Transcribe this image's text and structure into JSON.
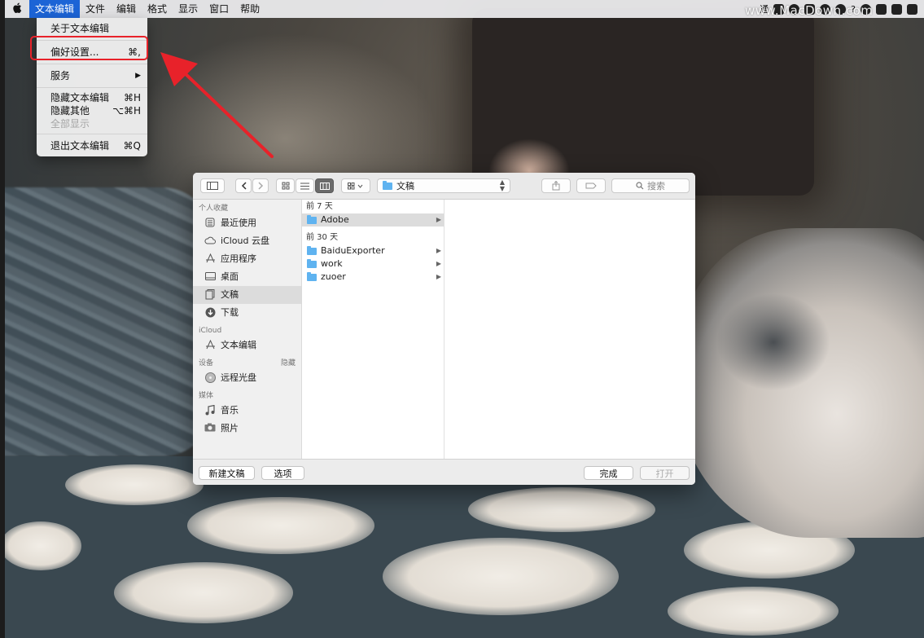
{
  "menubar": {
    "apple_icon": "apple-icon",
    "items": [
      "文本编辑",
      "文件",
      "编辑",
      "格式",
      "显示",
      "窗口",
      "帮助"
    ],
    "active_index": 0,
    "status_text": "通",
    "status_question": "?"
  },
  "watermark": "www.MacDown.com",
  "app_menu": {
    "about": "关于文本编辑",
    "preferences": "偏好设置...",
    "preferences_shortcut": "⌘,",
    "services": "服务",
    "services_arrow": "▶",
    "hide_app": "隐藏文本编辑",
    "hide_app_shortcut": "⌘H",
    "hide_others": "隐藏其他",
    "hide_others_shortcut": "⌥⌘H",
    "show_all": "全部显示",
    "quit": "退出文本编辑",
    "quit_shortcut": "⌘Q"
  },
  "annotation": {
    "highlight_color": "#e8222a",
    "arrow_color": "#e8222a"
  },
  "dialog": {
    "toolbar": {
      "sidebar_toggle_icon": "sidebar-icon",
      "back_icon": "chevron-left-icon",
      "forward_icon": "chevron-right-icon",
      "view_icon_icon": "grid-icon",
      "view_list_icon": "list-icon",
      "view_column_icon": "columns-icon",
      "group_icon": "group-icon",
      "path_location": "文稿",
      "share_icon": "share-icon",
      "tag_icon": "tag-icon",
      "search_placeholder": "搜索"
    },
    "sidebar": {
      "favorites_header": "个人收藏",
      "favorites": [
        {
          "label": "最近使用",
          "icon": "recents-icon"
        },
        {
          "label": "iCloud 云盘",
          "icon": "cloud-icon"
        },
        {
          "label": "应用程序",
          "icon": "applications-icon"
        },
        {
          "label": "桌面",
          "icon": "desktop-icon"
        },
        {
          "label": "文稿",
          "icon": "documents-icon"
        },
        {
          "label": "下载",
          "icon": "downloads-icon"
        }
      ],
      "selected_index": 4,
      "icloud_header": "iCloud",
      "icloud_items": [
        {
          "label": "文本编辑",
          "icon": "applications-icon"
        }
      ],
      "devices_header": "设备",
      "devices_hide": "隐藏",
      "devices": [
        {
          "label": "远程光盘",
          "icon": "disc-icon"
        }
      ],
      "media_header": "媒体",
      "media": [
        {
          "label": "音乐",
          "icon": "music-icon"
        },
        {
          "label": "照片",
          "icon": "camera-icon"
        }
      ]
    },
    "browser": {
      "group1_header": "前 7 天",
      "group1_items": [
        "Adobe"
      ],
      "group2_header": "前 30 天",
      "group2_items": [
        "BaiduExporter",
        "work",
        "zuoer"
      ],
      "folder_color": "#5fb3f0"
    },
    "bottom": {
      "new_document": "新建文稿",
      "options": "选项",
      "done": "完成",
      "open": "打开"
    }
  }
}
